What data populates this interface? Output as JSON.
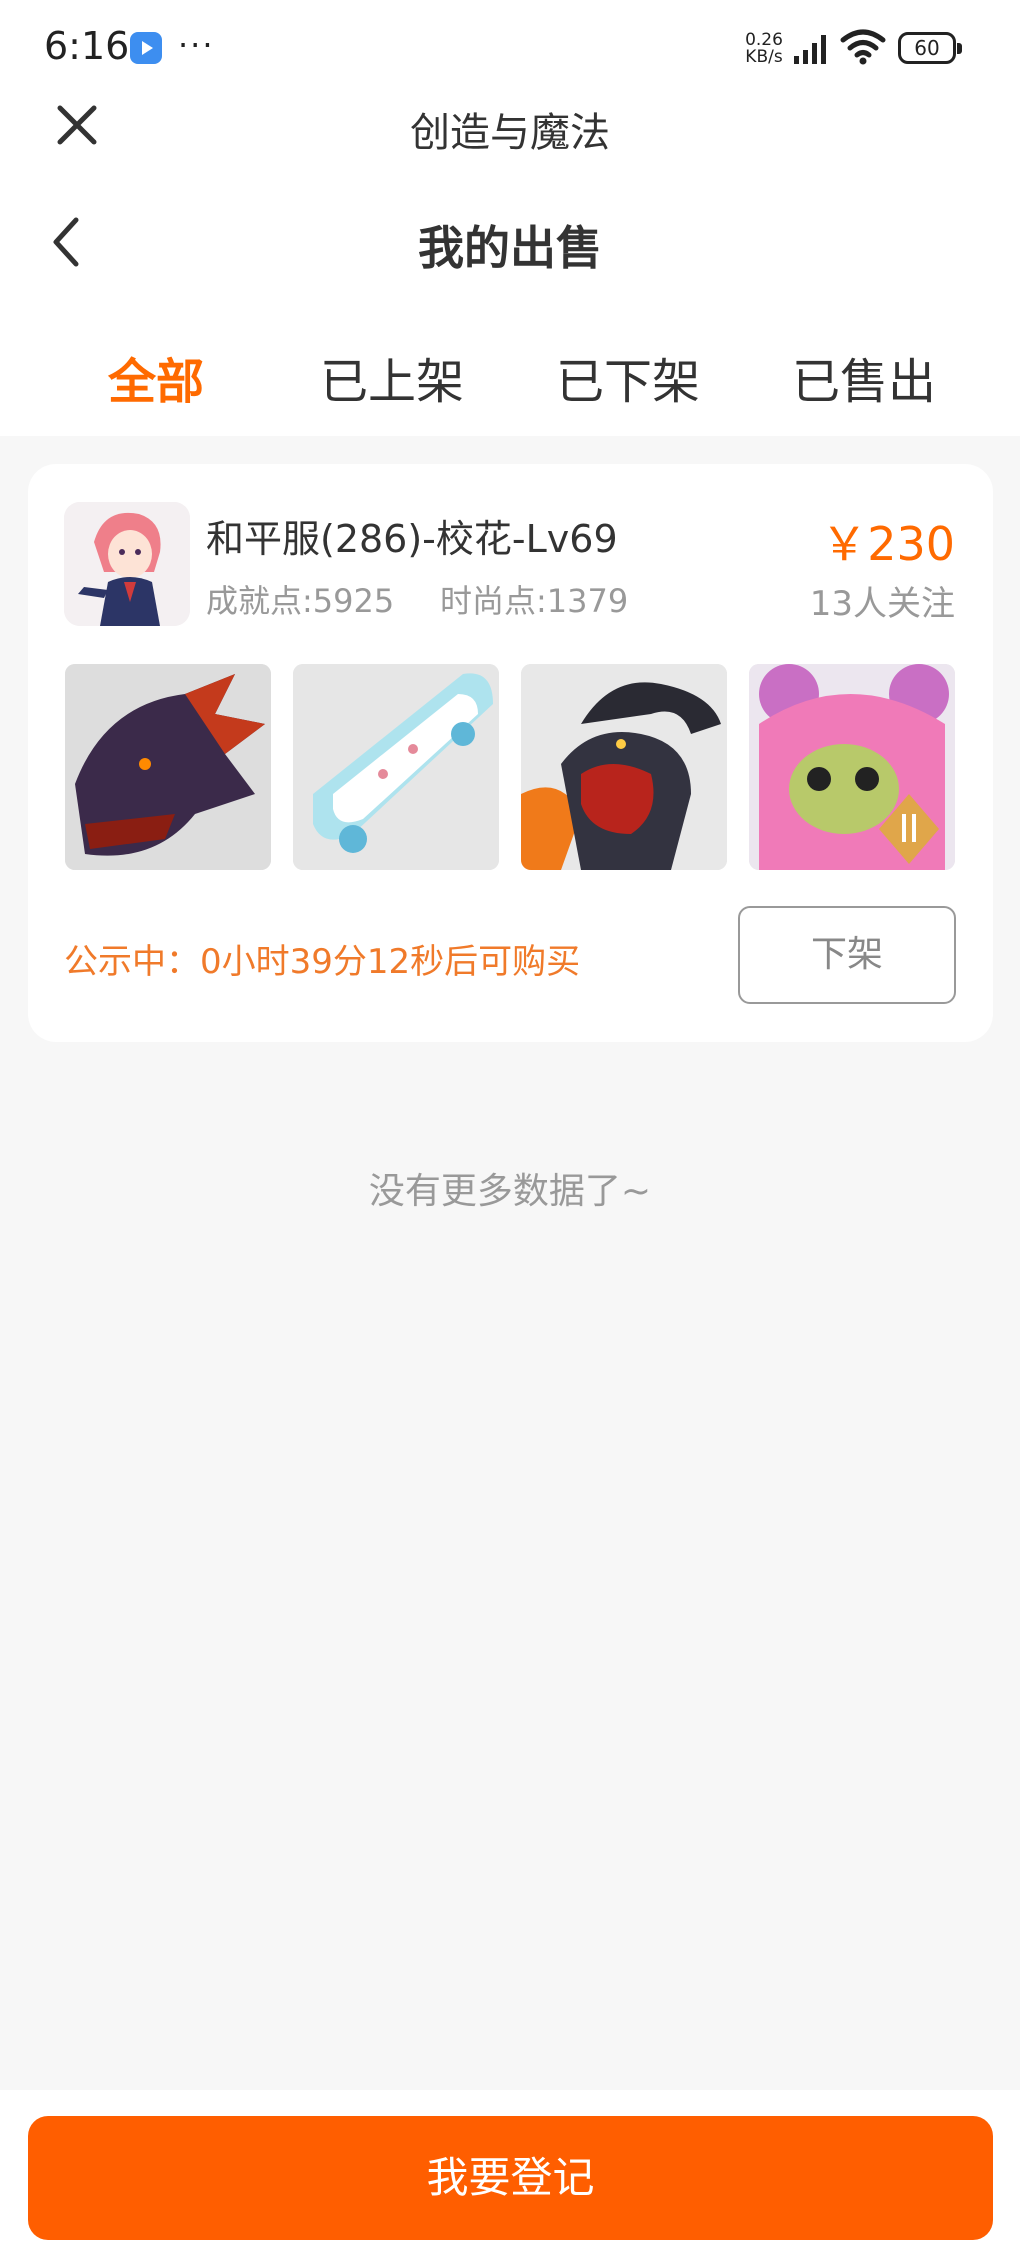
{
  "status_bar": {
    "time": "6:16",
    "network_speed_value": "0.26",
    "network_speed_unit": "KB/s",
    "battery_level": "60"
  },
  "app": {
    "title": "创造与魔法"
  },
  "nav": {
    "page_title": "我的出售"
  },
  "tabs": [
    {
      "label": "全部",
      "active": true
    },
    {
      "label": "已上架",
      "active": false
    },
    {
      "label": "已下架",
      "active": false
    },
    {
      "label": "已售出",
      "active": false
    }
  ],
  "listing": {
    "name": "和平服(286)-校花-Lv69",
    "achievement_points": "成就点:5925",
    "fashion_points": "时尚点:1379",
    "price": "￥230",
    "followers": "13人关注",
    "thumbnails": [
      "dragon-mount-icon",
      "skateboard-icon",
      "black-ram-mount-icon",
      "pink-bear-icon"
    ],
    "countdown": "公示中：0小时39分12秒后可购买",
    "delist_label": "下架"
  },
  "list_end_message": "没有更多数据了~",
  "bottom": {
    "register_label": "我要登记"
  },
  "colors": {
    "accent": "#ff6a00",
    "button": "#ff5e00"
  }
}
